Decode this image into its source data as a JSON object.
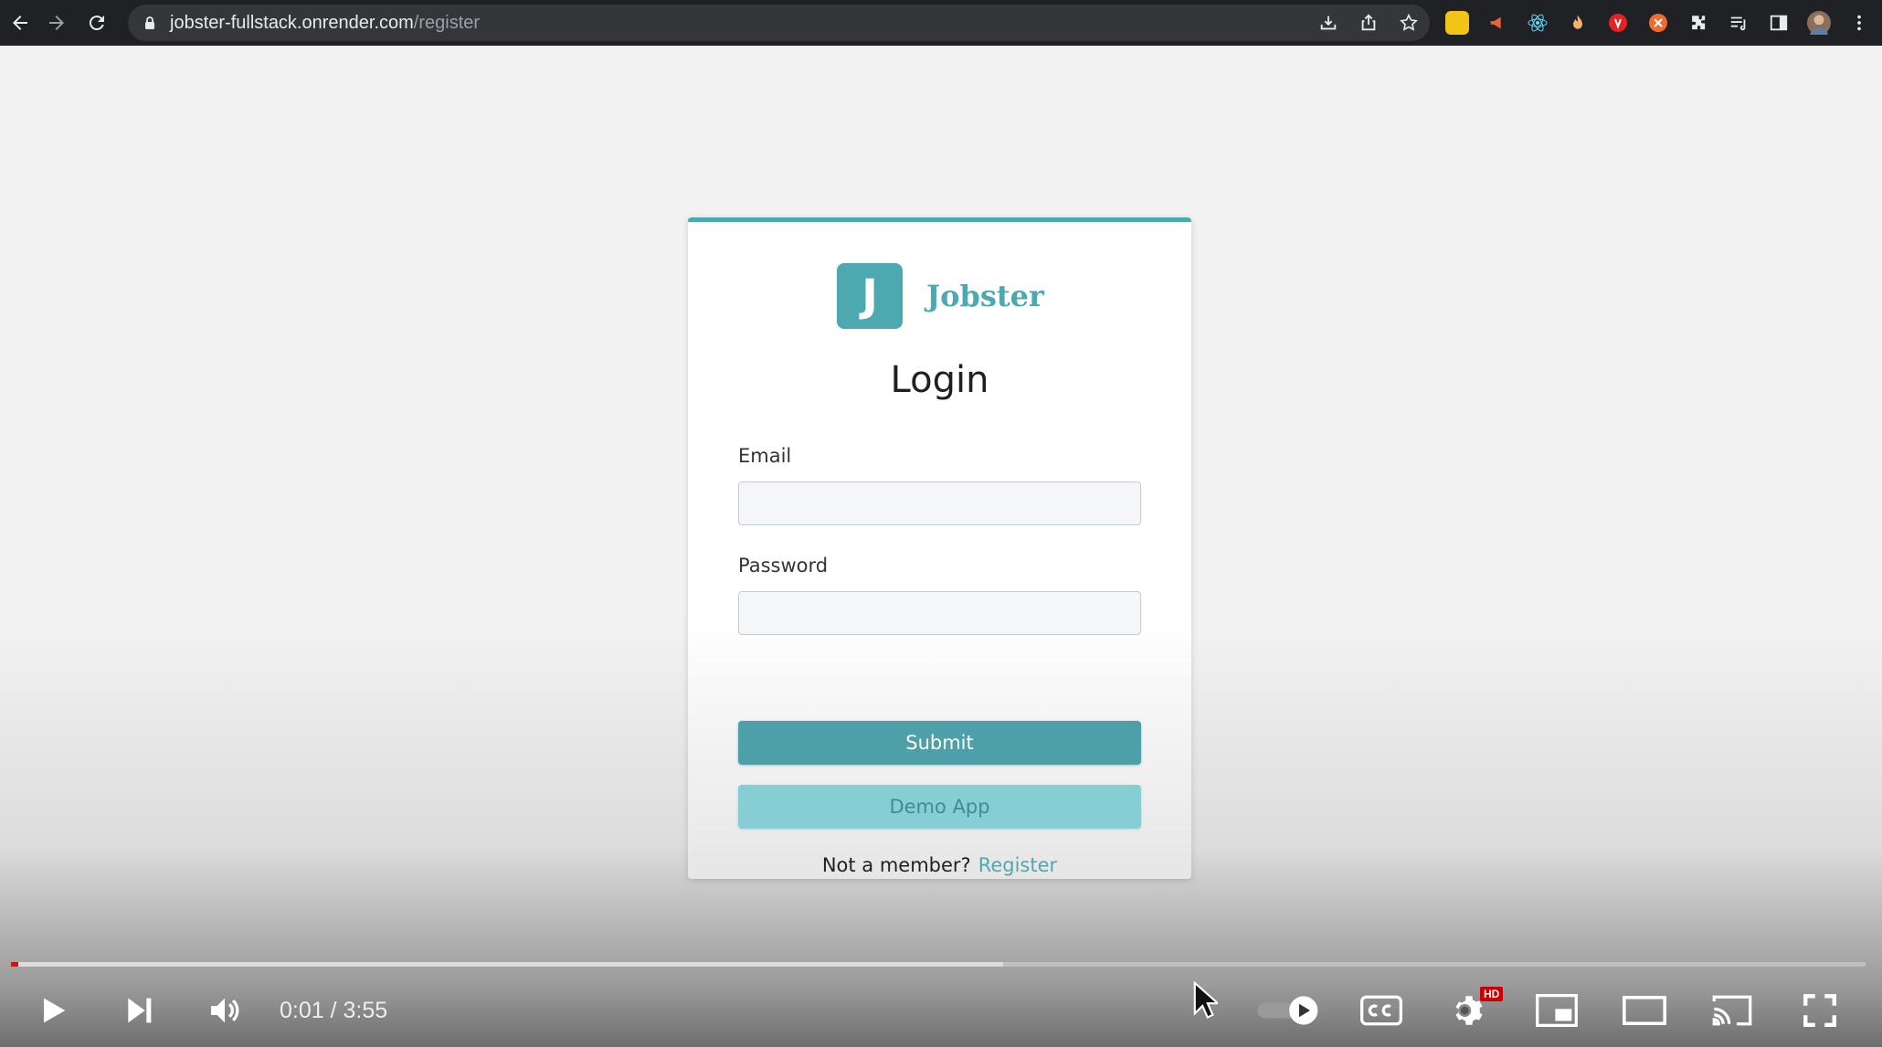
{
  "browser": {
    "url_host": "jobster-fullstack.onrender.com",
    "url_path": "/register",
    "icons": [
      "back-icon",
      "forward-icon",
      "reload-icon",
      "lock-icon",
      "install-icon",
      "share-icon",
      "bookmark-star-icon",
      "extensions-icon",
      "reading-list-icon",
      "side-panel-icon",
      "profile-avatar",
      "more-icon"
    ]
  },
  "login_card": {
    "logo_letter": "J",
    "logo_text": "Jobster",
    "title": "Login",
    "email_label": "Email",
    "email_value": "",
    "password_label": "Password",
    "password_value": "",
    "submit_label": "Submit",
    "demo_label": "Demo App",
    "member_text": "Not a member?",
    "register_link": "Register"
  },
  "player": {
    "current_time": "0:01",
    "duration": "3:55",
    "time_display": "0:01 / 3:55",
    "played_fraction": 0.004,
    "buffered_fraction": 0.535,
    "hd_badge": "HD",
    "autoplay_on": true
  },
  "colors": {
    "accent": "#4da9b0",
    "demo_button": "#86ced4",
    "progress_played": "#ff0000"
  }
}
